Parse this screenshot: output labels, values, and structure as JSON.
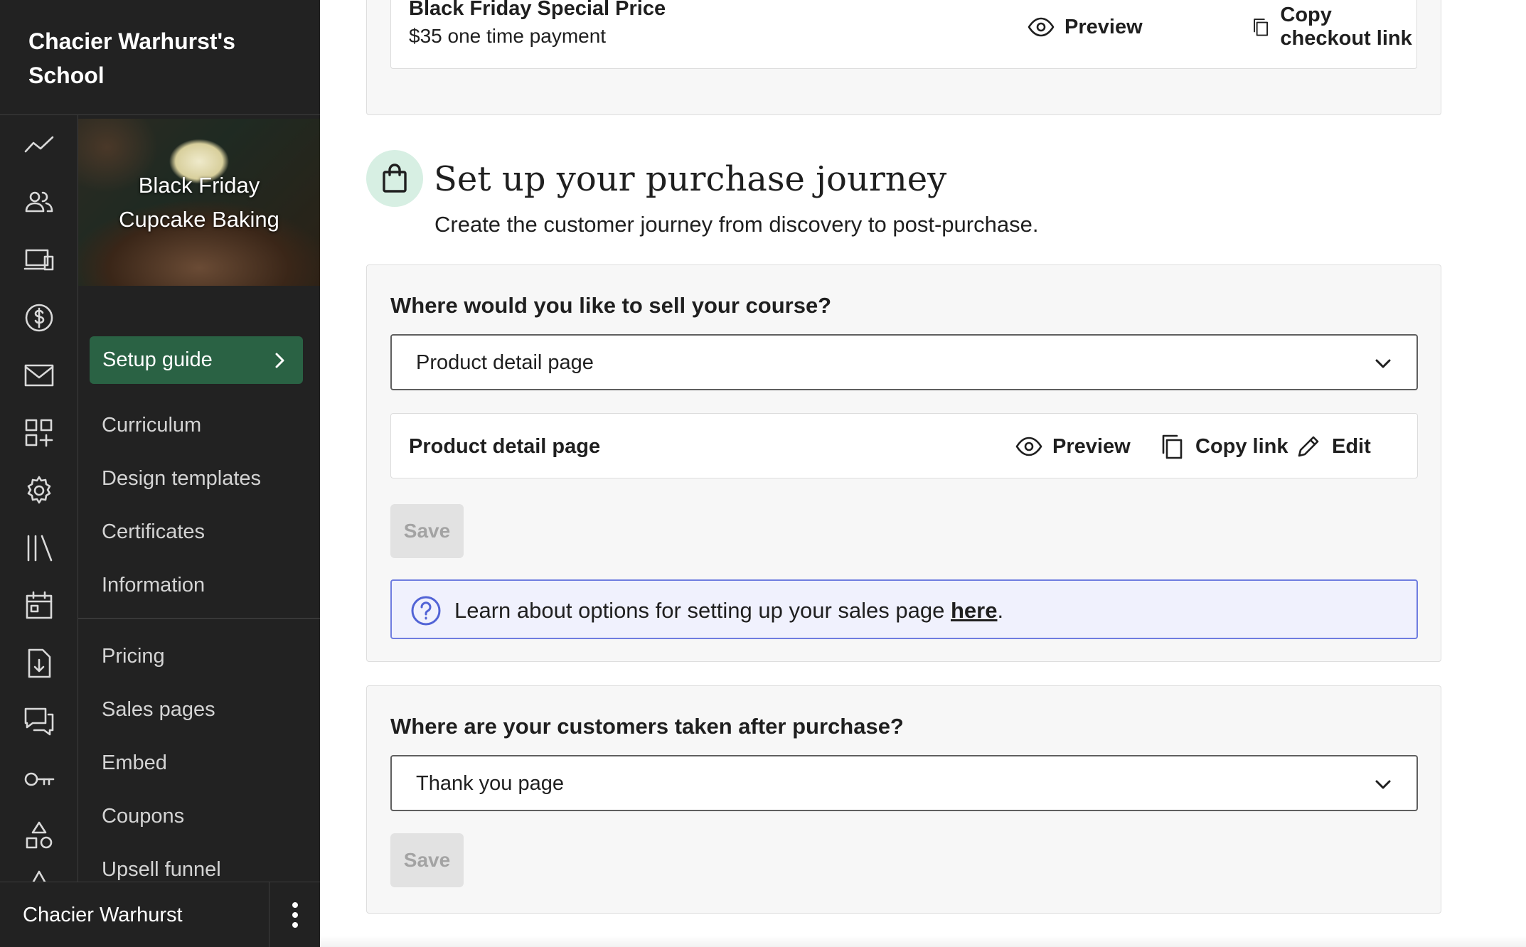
{
  "sidebar": {
    "school_name": "Chacier Warhurst's School",
    "course_title": "Black Friday Cupcake Baking",
    "setup_guide_label": "Setup guide",
    "rail_icons": [
      "analytics-icon",
      "users-icon",
      "devices-icon",
      "dollar-icon",
      "mail-icon",
      "apps-icon",
      "gear-icon",
      "library-icon",
      "calendar-icon",
      "download-file-icon",
      "chat-icon",
      "key-icon",
      "shapes-icon",
      "more-icon"
    ],
    "nav_items": [
      {
        "label": "Curriculum"
      },
      {
        "label": "Design templates"
      },
      {
        "label": "Certificates"
      },
      {
        "label": "Information"
      },
      {
        "label": "Pricing"
      },
      {
        "label": "Sales pages"
      },
      {
        "label": "Embed"
      },
      {
        "label": "Coupons"
      },
      {
        "label": "Upsell funnel"
      }
    ],
    "user_name": "Chacier Warhurst"
  },
  "pricing": {
    "price_name": "Black Friday Special Price",
    "price_detail": "$35 one time payment",
    "preview_label": "Preview",
    "copy_checkout_label": "Copy checkout link"
  },
  "journey": {
    "title": "Set up your purchase journey",
    "subtitle": "Create the customer journey from discovery to post-purchase."
  },
  "sell_section": {
    "question": "Where would you like to sell your course?",
    "selected_option": "Product detail page",
    "detail_label": "Product detail page",
    "preview_label": "Preview",
    "copy_link_label": "Copy link",
    "edit_label": "Edit",
    "save_label": "Save",
    "info_text": "Learn about options for setting up your sales page ",
    "info_link": "here",
    "info_suffix": "."
  },
  "after_section": {
    "question": "Where are your customers taken after purchase?",
    "selected_option": "Thank you page",
    "save_label": "Save"
  },
  "colors": {
    "sidebar_bg": "#222222",
    "setup_guide_bg": "#2a6244",
    "badge_bg": "#d7efe3",
    "info_border": "#6f7de0",
    "info_bg": "#f0f1fd"
  }
}
